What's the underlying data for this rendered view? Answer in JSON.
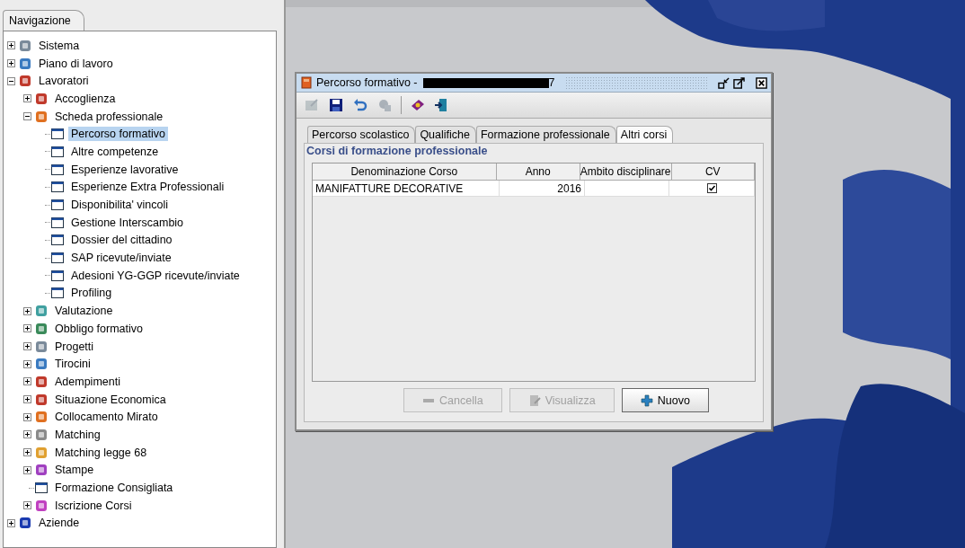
{
  "navigation": {
    "tab": "Navigazione",
    "tree": [
      {
        "label": "Sistema",
        "expanded": false,
        "selected": false
      },
      {
        "label": "Piano di lavoro",
        "expanded": false,
        "selected": false
      },
      {
        "label": "Lavoratori",
        "expanded": true,
        "selected": false,
        "children": [
          {
            "label": "Accoglienza",
            "expanded": false,
            "selected": false
          },
          {
            "label": "Scheda professionale",
            "expanded": true,
            "selected": false,
            "children": [
              {
                "label": "Percorso formativo",
                "selected": true
              },
              {
                "label": "Altre competenze",
                "selected": false
              },
              {
                "label": "Esperienze lavorative",
                "selected": false
              },
              {
                "label": "Esperienze Extra Professionali",
                "selected": false
              },
              {
                "label": "Disponibilita' vincoli",
                "selected": false
              },
              {
                "label": "Gestione Interscambio",
                "selected": false
              },
              {
                "label": "Dossier del cittadino",
                "selected": false
              },
              {
                "label": "SAP ricevute/inviate",
                "selected": false
              },
              {
                "label": "Adesioni YG-GGP ricevute/inviate",
                "selected": false
              },
              {
                "label": "Profiling",
                "selected": false
              }
            ]
          },
          {
            "label": "Valutazione",
            "expanded": false,
            "selected": false
          },
          {
            "label": "Obbligo formativo",
            "expanded": false,
            "selected": false
          },
          {
            "label": "Progetti",
            "expanded": false,
            "selected": false
          },
          {
            "label": "Tirocini",
            "expanded": false,
            "selected": false
          },
          {
            "label": "Adempimenti",
            "expanded": false,
            "selected": false
          },
          {
            "label": "Situazione Economica",
            "expanded": false,
            "selected": false
          },
          {
            "label": "Collocamento Mirato",
            "expanded": false,
            "selected": false
          },
          {
            "label": "Matching",
            "expanded": false,
            "selected": false
          },
          {
            "label": "Matching legge 68",
            "expanded": false,
            "selected": false
          },
          {
            "label": "Stampe",
            "expanded": false,
            "selected": false
          },
          {
            "label": "Formazione Consigliata",
            "selected": false
          },
          {
            "label": "Iscrizione Corsi",
            "expanded": false,
            "selected": false
          }
        ]
      },
      {
        "label": "Aziende",
        "expanded": false,
        "selected": false
      }
    ]
  },
  "dialog": {
    "title": "Percorso formativo -",
    "title_suffix": "7",
    "toolbar": [
      {
        "disabled": true
      },
      {
        "disabled": false
      },
      {
        "disabled": false
      },
      {
        "disabled": true
      },
      {
        "disabled": false
      },
      {
        "disabled": false
      }
    ],
    "tabs": [
      {
        "label": "Percorso scolastico",
        "selected": false
      },
      {
        "label": "Qualifiche",
        "selected": false
      },
      {
        "label": "Formazione professionale",
        "selected": false
      },
      {
        "label": "Altri corsi",
        "selected": true
      }
    ],
    "group_title": "Corsi di formazione professionale",
    "table": {
      "columns": [
        "Denominazione Corso",
        "Anno",
        "Ambito disciplinare",
        "CV"
      ],
      "rows": [
        {
          "denominazione": "MANIFATTURE DECORATIVE",
          "anno": "2016",
          "cv": true
        }
      ]
    },
    "buttons": [
      {
        "label": "Cancella",
        "disabled": true
      },
      {
        "label": "Visualizza",
        "disabled": true
      },
      {
        "label": "Nuovo",
        "disabled": false
      }
    ]
  }
}
